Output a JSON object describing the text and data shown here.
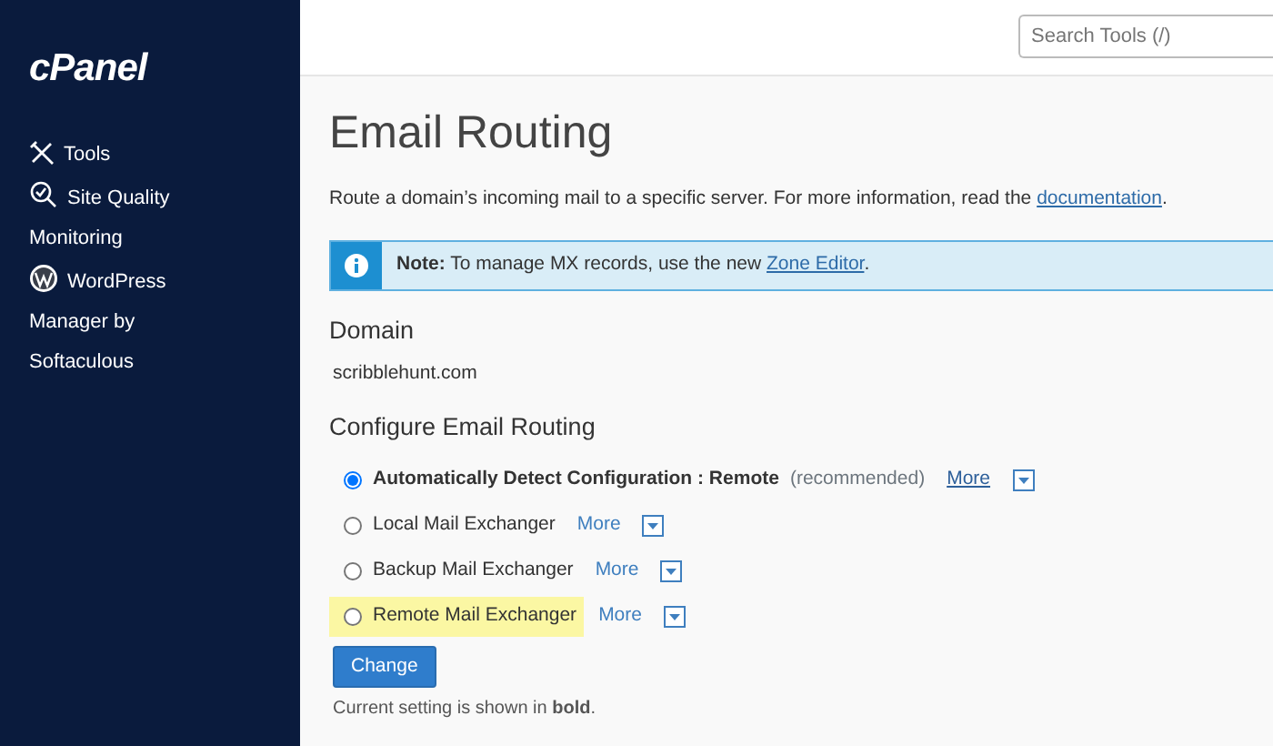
{
  "sidebar": {
    "logo": "cPanel",
    "items": [
      {
        "label": "Tools",
        "kind": "tools"
      },
      {
        "label": "Site Quality Monitoring",
        "kind": "quality"
      },
      {
        "label": "WordPress Manager by Softaculous",
        "kind": "wordpress"
      }
    ]
  },
  "search": {
    "placeholder": "Search Tools (/)"
  },
  "title": "Email Routing",
  "description": {
    "text": "Route a domain’s incoming mail to a specific server. For more information, read the ",
    "link": "documentation",
    "after": "."
  },
  "note": {
    "label": "Note:",
    "text": " To manage MX records, use the new ",
    "link": "Zone Editor",
    "after": "."
  },
  "domain": {
    "heading": "Domain",
    "value": "scribblehunt.com"
  },
  "routing": {
    "heading": "Configure Email Routing",
    "options": [
      {
        "label": "Automatically Detect Configuration : Remote",
        "note": "(recommended)",
        "selected": true,
        "current": true,
        "highlighted": false,
        "more": "More"
      },
      {
        "label": "Local Mail Exchanger",
        "selected": false,
        "current": false,
        "highlighted": false,
        "more": "More"
      },
      {
        "label": "Backup Mail Exchanger",
        "selected": false,
        "current": false,
        "highlighted": false,
        "more": "More"
      },
      {
        "label": "Remote Mail Exchanger",
        "selected": false,
        "current": false,
        "highlighted": true,
        "more": "More"
      }
    ],
    "button": "Change",
    "footer": "Current setting is shown in **bold**."
  }
}
